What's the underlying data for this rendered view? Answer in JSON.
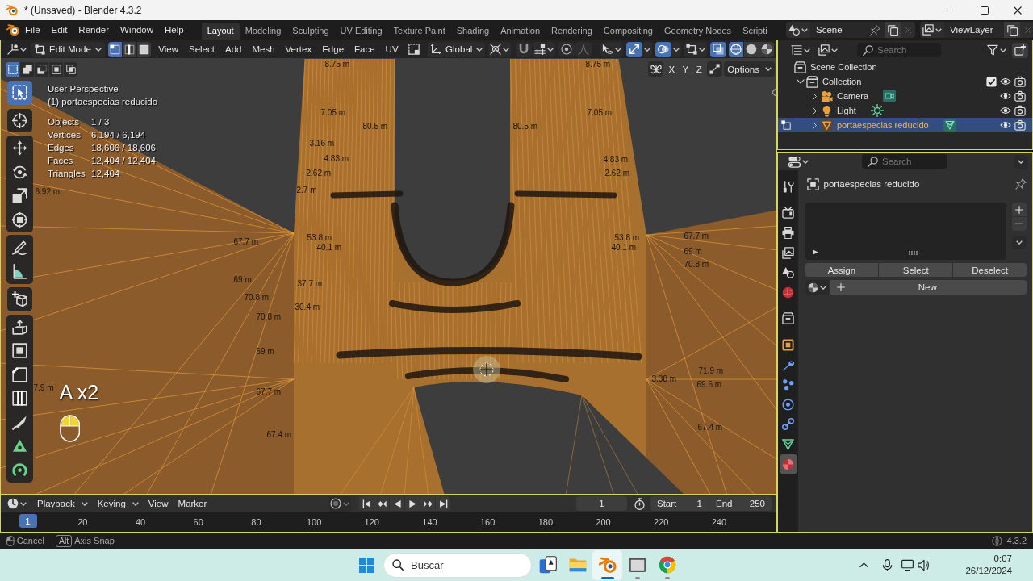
{
  "window": {
    "title": "* (Unsaved) - Blender 4.3.2"
  },
  "menu_bar": [
    "File",
    "Edit",
    "Render",
    "Window",
    "Help"
  ],
  "workspace_tabs": [
    {
      "label": "Layout",
      "selected": true
    },
    {
      "label": "Modeling",
      "selected": false
    },
    {
      "label": "Sculpting",
      "selected": false
    },
    {
      "label": "UV Editing",
      "selected": false
    },
    {
      "label": "Texture Paint",
      "selected": false
    },
    {
      "label": "Shading",
      "selected": false
    },
    {
      "label": "Animation",
      "selected": false
    },
    {
      "label": "Rendering",
      "selected": false
    },
    {
      "label": "Compositing",
      "selected": false
    },
    {
      "label": "Geometry Nodes",
      "selected": false
    },
    {
      "label": "Scripti",
      "selected": false
    }
  ],
  "scene_selector": {
    "scene": "Scene",
    "view_layer": "ViewLayer"
  },
  "viewport": {
    "mode": "Edit Mode",
    "select_modes": [
      {
        "kind": "vertex",
        "selected": true
      },
      {
        "kind": "edge",
        "selected": false
      },
      {
        "kind": "face",
        "selected": false
      }
    ],
    "menus": [
      "View",
      "Select",
      "Add",
      "Mesh",
      "Vertex",
      "Edge",
      "Face",
      "UV"
    ],
    "orientation": "Global",
    "toggles": [
      {
        "kind": "snap",
        "on": false
      },
      {
        "kind": "proportional",
        "on": false
      },
      {
        "kind": "gizmo",
        "on": true
      },
      {
        "kind": "overlays",
        "on": true
      },
      {
        "kind": "xray",
        "on": true
      }
    ],
    "shading": [
      {
        "kind": "wireframe",
        "selected": true
      },
      {
        "kind": "solid",
        "selected": false
      },
      {
        "kind": "material",
        "selected": false
      }
    ],
    "selection_ops": [
      {
        "kind": "set",
        "selected": true
      },
      {
        "kind": "extend",
        "selected": false
      },
      {
        "kind": "subtract",
        "selected": false
      },
      {
        "kind": "invert",
        "selected": false
      },
      {
        "kind": "intersect",
        "selected": false
      }
    ],
    "mirror_axes": [
      {
        "label": "X",
        "on": false
      },
      {
        "label": "Y",
        "on": false
      },
      {
        "label": "Z",
        "on": false
      }
    ],
    "options": "Options",
    "view_name": "User Perspective",
    "object_name": "(1) portaespecias reducido",
    "stats": [
      {
        "label": "Objects",
        "value": "1 / 3"
      },
      {
        "label": "Vertices",
        "value": "6,194 / 6,194"
      },
      {
        "label": "Edges",
        "value": "18,606 / 18,606"
      },
      {
        "label": "Faces",
        "value": "12,404 / 12,404"
      },
      {
        "label": "Triangles",
        "value": "12,404"
      }
    ],
    "tool_groups": [
      [
        {
          "kind": "select_box",
          "selected": true
        }
      ],
      [
        {
          "kind": "cursor",
          "selected": false
        }
      ],
      [
        {
          "kind": "move",
          "selected": false
        },
        {
          "kind": "rotate",
          "selected": false
        },
        {
          "kind": "scale",
          "selected": false
        },
        {
          "kind": "transform",
          "selected": false
        }
      ],
      [
        {
          "kind": "annotate",
          "selected": false
        },
        {
          "kind": "measure",
          "selected": false
        }
      ],
      [
        {
          "kind": "add_cube",
          "selected": false
        }
      ],
      [
        {
          "kind": "extrude",
          "selected": false
        },
        {
          "kind": "inset",
          "selected": false
        },
        {
          "kind": "bevel",
          "selected": false
        },
        {
          "kind": "loop_cut",
          "selected": false
        },
        {
          "kind": "knife",
          "selected": false
        },
        {
          "kind": "poly_build",
          "selected": false
        },
        {
          "kind": "spin",
          "selected": false
        }
      ]
    ],
    "edge_length_labels": [
      "8.75 m",
      "8.75 m",
      "80.5 m",
      "80.5 m",
      "6.92 m",
      "7.05 m",
      "3.16 m",
      "4.83 m",
      "2.62 m",
      "2.7 m",
      "53.8 m",
      "40.1 m",
      "37.7 m",
      "30.4 m",
      "67.7 m",
      "69 m",
      "70.8 m",
      "70.8 m",
      "69 m",
      "67.7 m",
      "67.4 m",
      "7.9 m",
      "7.05 m",
      "4.83 m",
      "2.62 m",
      "53.8 m",
      "40.1 m",
      "67.7 m",
      "69 m",
      "70.8 m",
      "71.9 m",
      "69.6 m",
      "67.4 m",
      "3.38 m"
    ],
    "key_overlay": "A x2"
  },
  "timeline": {
    "menus": [
      {
        "label": "Playback",
        "dropdown": true
      },
      {
        "label": "Keying",
        "dropdown": true
      },
      {
        "label": "View",
        "dropdown": false
      },
      {
        "label": "Marker",
        "dropdown": false
      }
    ],
    "auto_keying": false,
    "current_frame": "1",
    "start_label": "Start",
    "start": "1",
    "end_label": "End",
    "end": "250",
    "playhead": "1",
    "ruler": [
      "20",
      "40",
      "60",
      "80",
      "100",
      "120",
      "140",
      "160",
      "180",
      "200",
      "220",
      "240"
    ]
  },
  "outliner": {
    "search_placeholder": "Search",
    "tree": [
      {
        "label": "Scene Collection",
        "kind": "scene_collection",
        "selected": false,
        "children": [
          {
            "label": "Collection",
            "kind": "collection",
            "expanded": true,
            "selected": false,
            "checked": true,
            "visible": true,
            "renderable": true,
            "children": [
              {
                "label": "Camera",
                "kind": "camera",
                "expanded": false,
                "selected": false,
                "edit_mode": false,
                "visible": true,
                "renderable": true
              },
              {
                "label": "Light",
                "kind": "light",
                "expanded": false,
                "selected": false,
                "edit_mode": false,
                "visible": true,
                "renderable": true
              },
              {
                "label": "portaespecias reducido",
                "kind": "mesh",
                "expanded": false,
                "selected": true,
                "edit_mode": true,
                "visible": true,
                "renderable": true
              }
            ]
          }
        ]
      }
    ]
  },
  "properties": {
    "search_placeholder": "Search",
    "tab_groups": [
      [
        {
          "kind": "tool",
          "selected": false
        }
      ],
      [
        {
          "kind": "render",
          "selected": false
        },
        {
          "kind": "output",
          "selected": false
        },
        {
          "kind": "view_layer",
          "selected": false
        },
        {
          "kind": "scene",
          "selected": false
        },
        {
          "kind": "world",
          "selected": false
        }
      ],
      [
        {
          "kind": "collection",
          "selected": false
        }
      ],
      [
        {
          "kind": "object",
          "selected": false
        },
        {
          "kind": "modifiers",
          "selected": false
        },
        {
          "kind": "particles",
          "selected": false
        },
        {
          "kind": "physics",
          "selected": false
        },
        {
          "kind": "constraints",
          "selected": false
        },
        {
          "kind": "data",
          "selected": false
        },
        {
          "kind": "material",
          "selected": true
        }
      ]
    ],
    "object_name": "portaespecias reducido",
    "slot_actions": [
      "Assign",
      "Select",
      "Deselect"
    ],
    "new_label": "New"
  },
  "status_bar": {
    "hints": [
      {
        "kind": "mouse",
        "label": "Cancel"
      },
      {
        "kind": "key",
        "key": "Alt",
        "label": "Axis Snap"
      }
    ],
    "version": "4.3.2"
  },
  "taskbar": {
    "search_placeholder": "Buscar",
    "apps": [
      {
        "kind": "solitaire",
        "running": false,
        "selected": false
      },
      {
        "kind": "files",
        "running": false,
        "selected": false
      },
      {
        "kind": "blender",
        "running": true,
        "selected": true
      },
      {
        "kind": "app",
        "running": true,
        "selected": false
      },
      {
        "kind": "chrome",
        "running": true,
        "selected": false
      }
    ],
    "time": "0:07",
    "date": "26/12/2024"
  }
}
